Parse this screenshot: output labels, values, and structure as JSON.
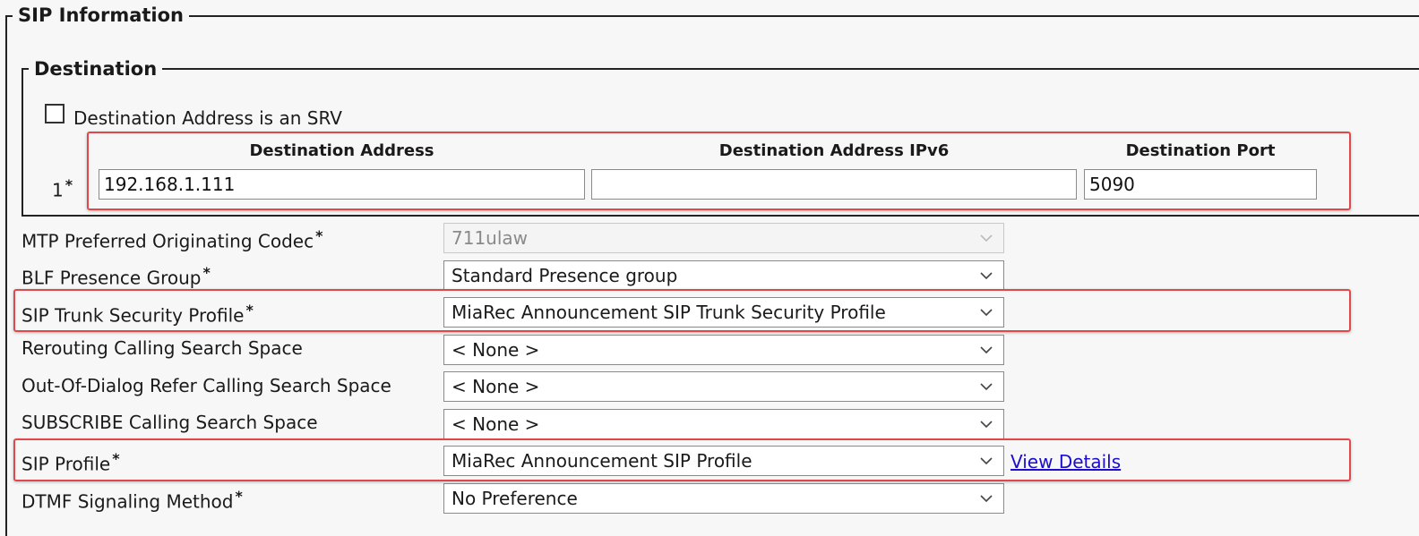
{
  "sip_information": {
    "legend": "SIP Information",
    "destination": {
      "legend": "Destination",
      "srv_checkbox_label": "Destination Address is an SRV",
      "srv_checked": false,
      "columns": {
        "address": "Destination Address",
        "ipv6": "Destination Address IPv6",
        "port": "Destination Port"
      },
      "rows": [
        {
          "index": "1",
          "address": "192.168.1.111",
          "ipv6": "",
          "port": "5090"
        }
      ]
    },
    "fields": {
      "mtp_codec": {
        "label": "MTP Preferred Originating Codec",
        "value": "711ulaw",
        "disabled": true
      },
      "blf_presence_group": {
        "label": "BLF Presence Group",
        "value": "Standard Presence group"
      },
      "sip_trunk_security_profile": {
        "label": "SIP Trunk Security Profile",
        "value": "MiaRec Announcement SIP Trunk Security Profile"
      },
      "rerouting_css": {
        "label": "Rerouting Calling Search Space",
        "value": "< None >"
      },
      "ood_refer_css": {
        "label": "Out-Of-Dialog Refer Calling Search Space",
        "value": "< None >"
      },
      "subscribe_css": {
        "label": "SUBSCRIBE Calling Search Space",
        "value": "< None >"
      },
      "sip_profile": {
        "label": "SIP Profile",
        "value": "MiaRec Announcement SIP Profile",
        "link": "View Details"
      },
      "dtmf_method": {
        "label": "DTMF Signaling Method",
        "value": "No Preference"
      }
    },
    "required_marker": "*"
  },
  "colors": {
    "highlight": "#e0484c",
    "link": "#1a0dcc",
    "background": "#f7f7f7"
  }
}
